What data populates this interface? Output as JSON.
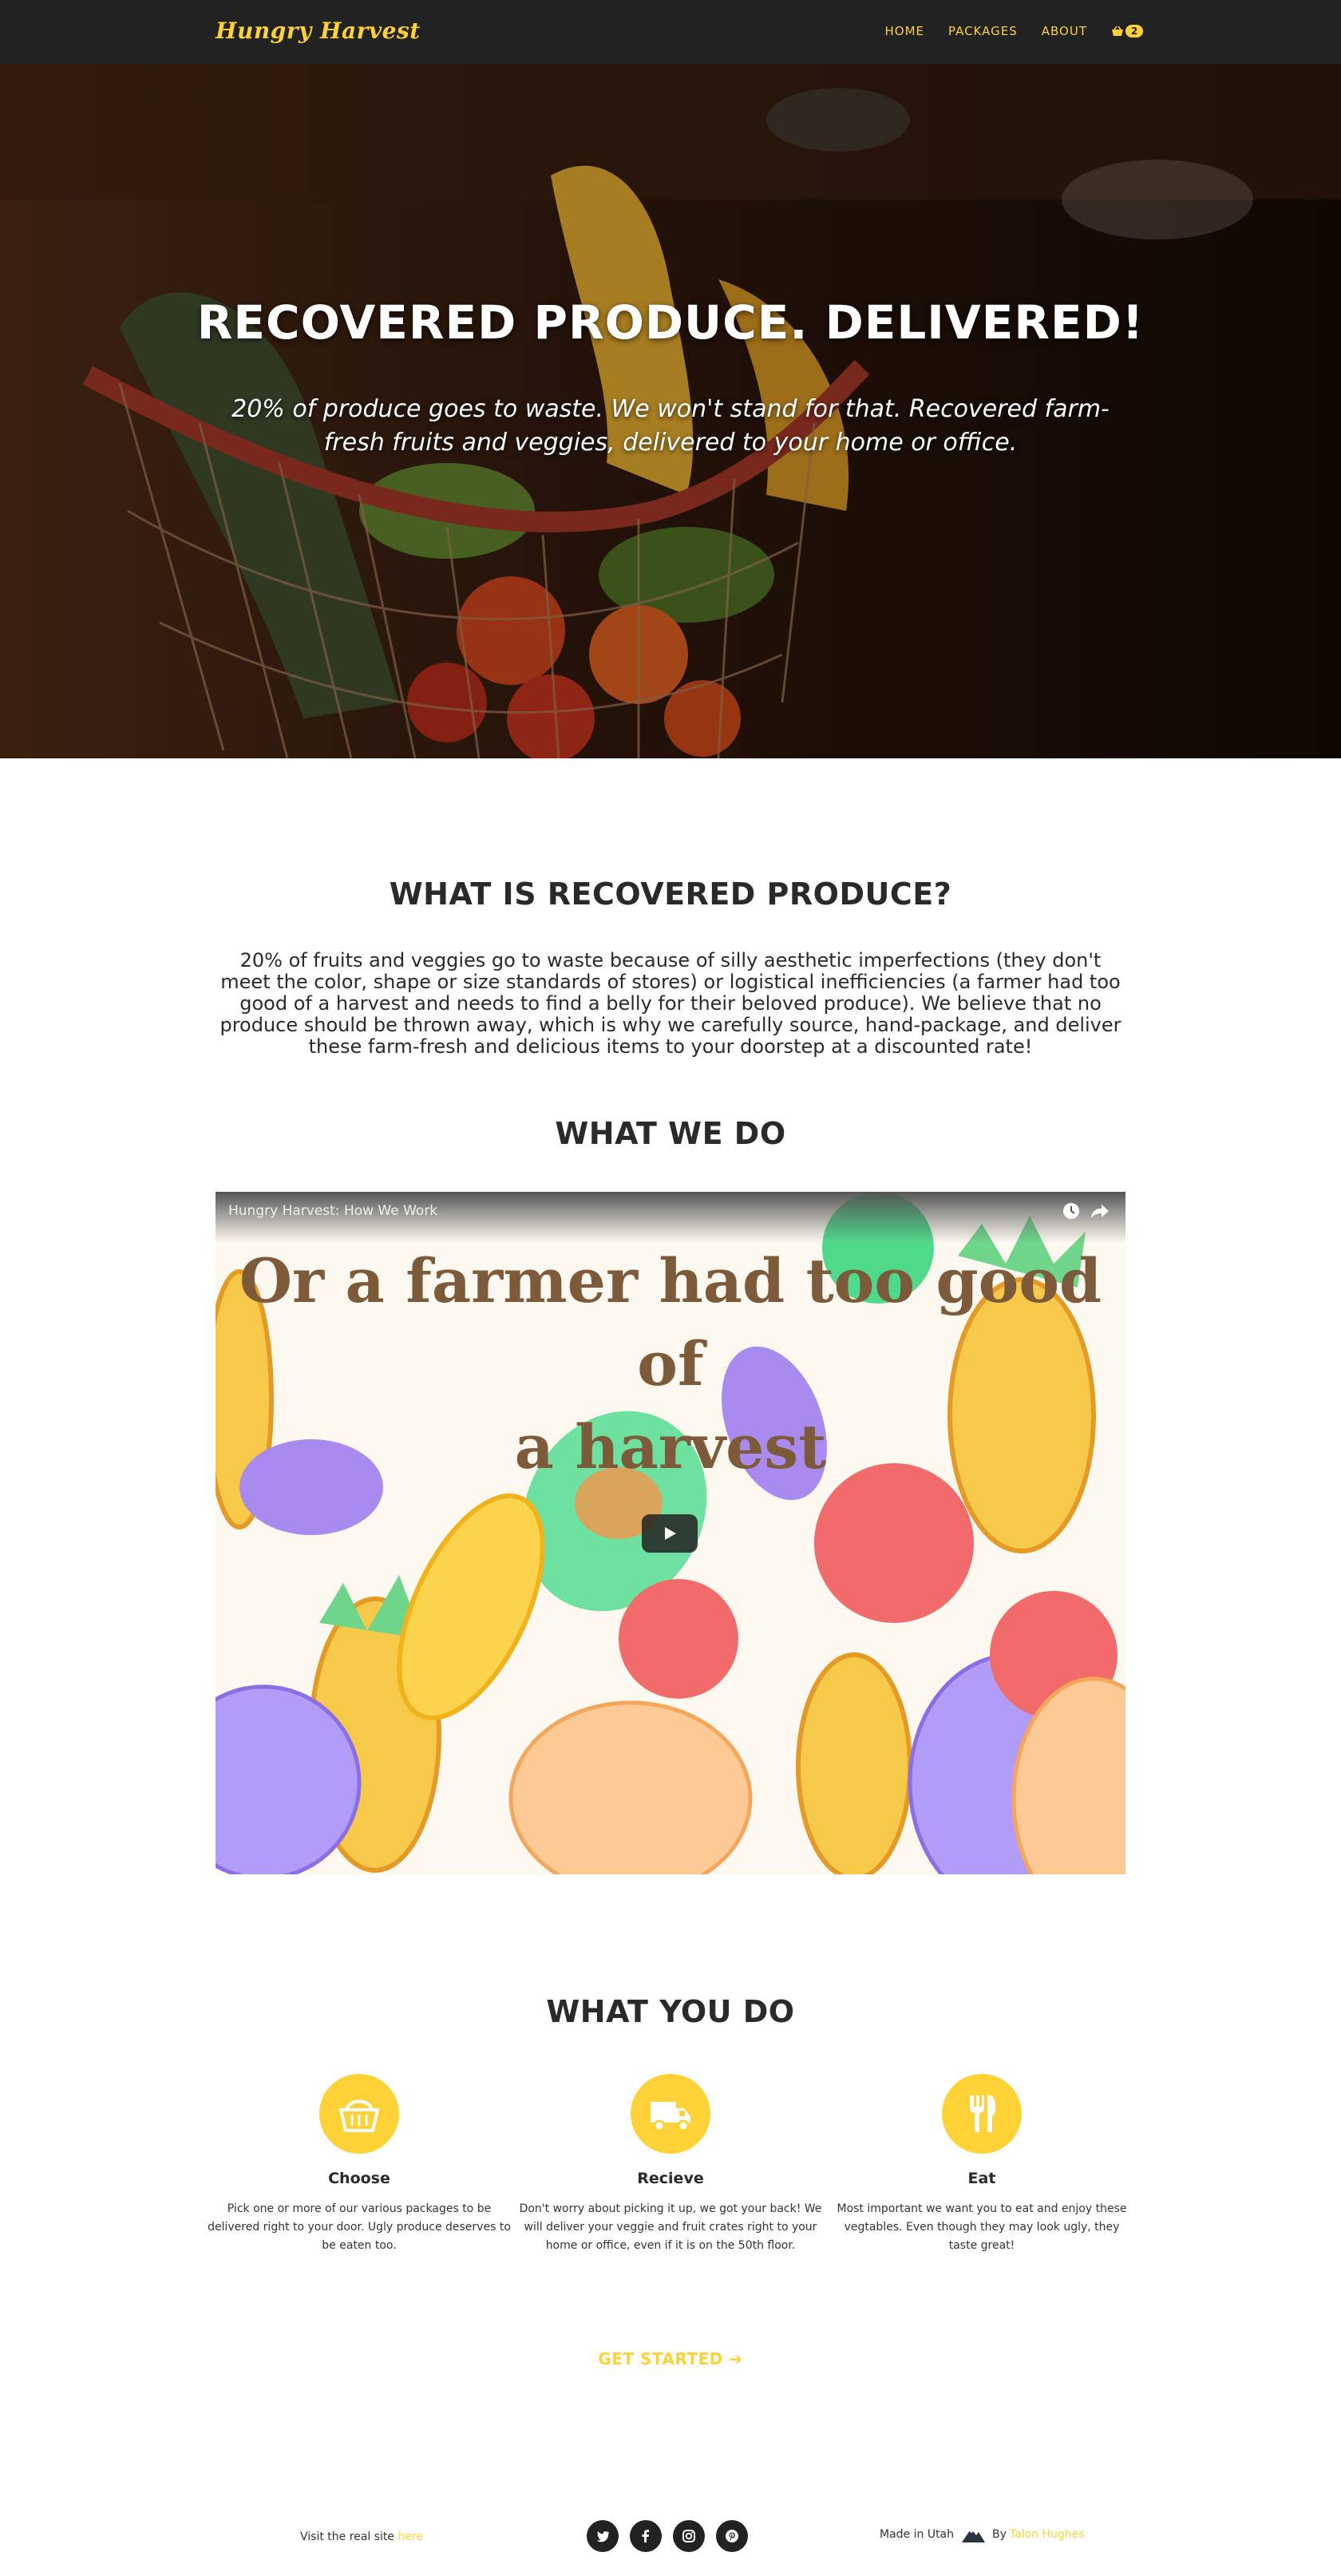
{
  "nav": {
    "brand": "Hungry Harvest",
    "links": [
      "HOME",
      "PACKAGES",
      "ABOUT"
    ],
    "cart_count": "2"
  },
  "hero": {
    "title": "RECOVERED PRODUCE. DELIVERED!",
    "subtitle": "20% of produce goes to waste. We won't stand for that. Recovered farm-fresh fruits and veggies, delivered to your home or office."
  },
  "recovered": {
    "heading": "WHAT IS RECOVERED PRODUCE?",
    "body": "20% of fruits and veggies go to waste because of silly aesthetic imperfections (they don't meet the color, shape or size standards of stores) or logistical inefficiencies (a farmer had too good of a harvest and needs to find a belly for their beloved produce). We believe that no produce should be thrown away, which is why we carefully source, hand-package, and deliver these farm-fresh and delicious items to your doorstep at a discounted rate!"
  },
  "what_we_do": {
    "heading": "WHAT WE DO",
    "video_title": "Hungry Harvest: How We Work",
    "video_caption_line1": "Or a farmer had too good of",
    "video_caption_line2": "a harvest"
  },
  "what_you_do": {
    "heading": "WHAT YOU DO",
    "features": [
      {
        "icon": "basket-icon",
        "name": "Choose",
        "text": "Pick one or more of our various packages to be delivered right to your door. Ugly produce deserves to be eaten too."
      },
      {
        "icon": "truck-icon",
        "name": "Recieve",
        "text": "Don't worry about picking it up, we got your back! We will deliver your veggie and fruit crates right to your home or office, even if it is on the 50th floor."
      },
      {
        "icon": "utensils-icon",
        "name": "Eat",
        "text": "Most important we want you to eat and enjoy these vegtables. Even though they may look ugly, they taste great!"
      }
    ],
    "cta": "GET STARTED"
  },
  "footer": {
    "visit_text": "Visit the real site",
    "visit_link": "here",
    "made_in": "Made in Utah",
    "by_text": "By",
    "author": "Talon Hughes",
    "socials": [
      "twitter-icon",
      "facebook-icon",
      "instagram-icon",
      "pinterest-icon"
    ]
  },
  "colors": {
    "accent": "#fed136",
    "nav_bg": "#222222",
    "heading": "#2a2a2a"
  }
}
